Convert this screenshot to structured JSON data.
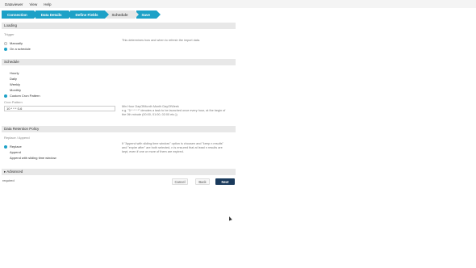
{
  "menubar": {
    "items": [
      "Dataviewer",
      "View",
      "Help"
    ]
  },
  "wizard": {
    "steps": [
      {
        "label": "Connection",
        "state": "done"
      },
      {
        "label": "Data Details",
        "state": "done"
      },
      {
        "label": "Define Fields",
        "state": "done"
      },
      {
        "label": "Schedule",
        "state": "current"
      },
      {
        "label": "Save",
        "state": "next"
      }
    ]
  },
  "loading": {
    "title": "Loading",
    "trigger_label": "Trigger",
    "options": [
      "Manually",
      "On a schedule"
    ],
    "selected": "On a schedule",
    "hint": "This determines how and when to refresh the import data."
  },
  "schedule": {
    "title": "Schedule",
    "options": [
      "Hourly",
      "Daily",
      "Weekly",
      "Monthly",
      "Custom Cron Pattern"
    ],
    "selected": "Custom Cron Pattern",
    "cron_label": "Cron Pattern",
    "cron_value": "10 * * * 0-6",
    "hint_line1": "Min Hour DayOfMonth Month DayOfWeek",
    "hint_line2": "e.g. \"0 * * * *\" denotes a task to be launched once every hour, at the begin of",
    "hint_line3": "the 0th minute (00:00, 01:00, 02:00 etc.))"
  },
  "retention": {
    "title": "Data Retention Policy",
    "sub_label": "Replace / Append",
    "options": [
      "Replace",
      "Append",
      "Append with sliding time window"
    ],
    "selected": "Replace",
    "hint_line1": "If \"Append with sliding time window\" option is choosen and \"keep n results\"",
    "hint_line2": "and \"expire after\" are both selected, n is ensured that at least n results are",
    "hint_line3": "kept, even if one or more of them are expired."
  },
  "advanced": {
    "label": "Advanced"
  },
  "footer": {
    "required_text": "required",
    "cancel": "Cancel",
    "back": "Back",
    "next": "Next"
  },
  "colors": {
    "accent": "#1da1c7",
    "primary_button": "#1a3a5c"
  }
}
